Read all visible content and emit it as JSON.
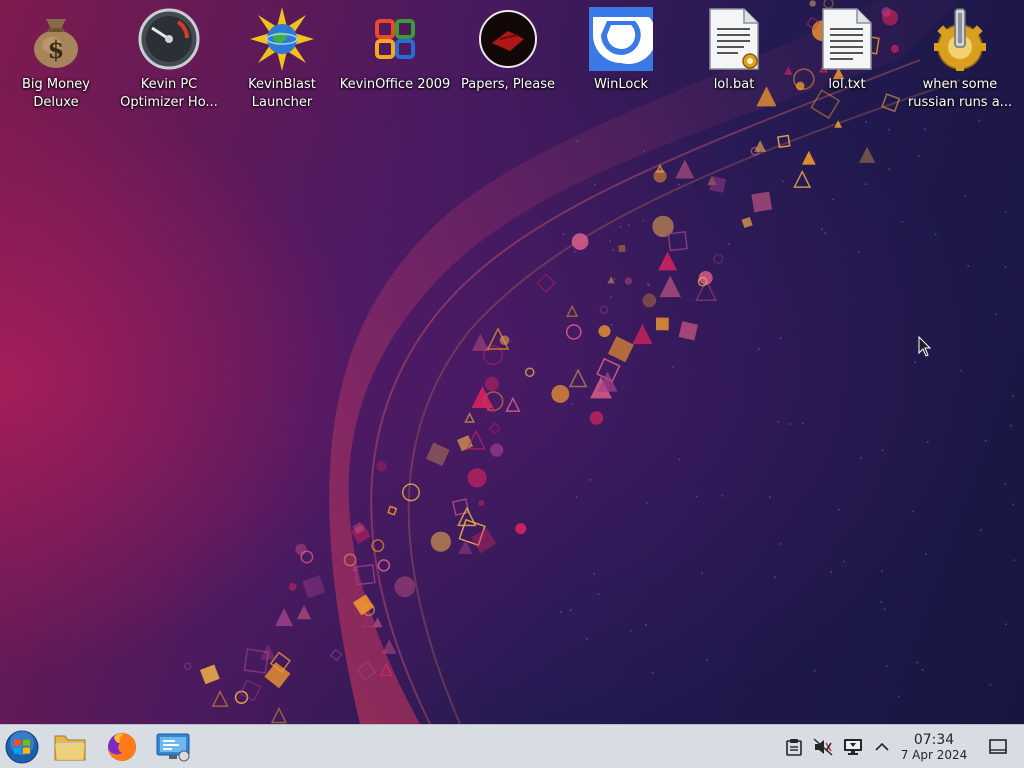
{
  "desktop": {
    "icons": [
      {
        "label": "Big Money Deluxe",
        "icon": "money-bag-icon"
      },
      {
        "label": "Kevin PC Optimizer Ho...",
        "icon": "speedometer-gauge-icon"
      },
      {
        "label": "KevinBlast Launcher",
        "icon": "globe-starburst-icon"
      },
      {
        "label": "KevinOffice 2009",
        "icon": "office-logo-icon"
      },
      {
        "label": "Papers, Please",
        "icon": "papers-please-emblem-icon"
      },
      {
        "label": "WinLock",
        "icon": "winlock-icon"
      },
      {
        "label": "lol.bat",
        "icon": "batch-script-file-icon"
      },
      {
        "label": "lol.txt",
        "icon": "text-file-icon"
      },
      {
        "label": "when some russian runs a...",
        "icon": "gear-executable-icon"
      }
    ]
  },
  "taskbar": {
    "start": {
      "icon": "start-menu-orb-icon"
    },
    "pinned": [
      {
        "icon": "file-manager-folder-icon"
      },
      {
        "icon": "firefox-icon"
      },
      {
        "icon": "system-settings-icon"
      }
    ],
    "tray": [
      {
        "icon": "clipboard-icon"
      },
      {
        "icon": "speaker-muted-icon"
      },
      {
        "icon": "display-monitor-icon"
      },
      {
        "icon": "chevron-up-icon"
      }
    ],
    "clock": {
      "time": "07:34",
      "date": "7 Apr 2024"
    },
    "show_desktop": {
      "icon": "show-desktop-icon"
    }
  },
  "colors": {
    "taskbar_bg": "#d8dde3",
    "wallpaper_pink": "#7e1b4f",
    "wallpaper_navy": "#171640",
    "accent_orange": "#f39a2e",
    "accent_magenta": "#d6245e"
  }
}
